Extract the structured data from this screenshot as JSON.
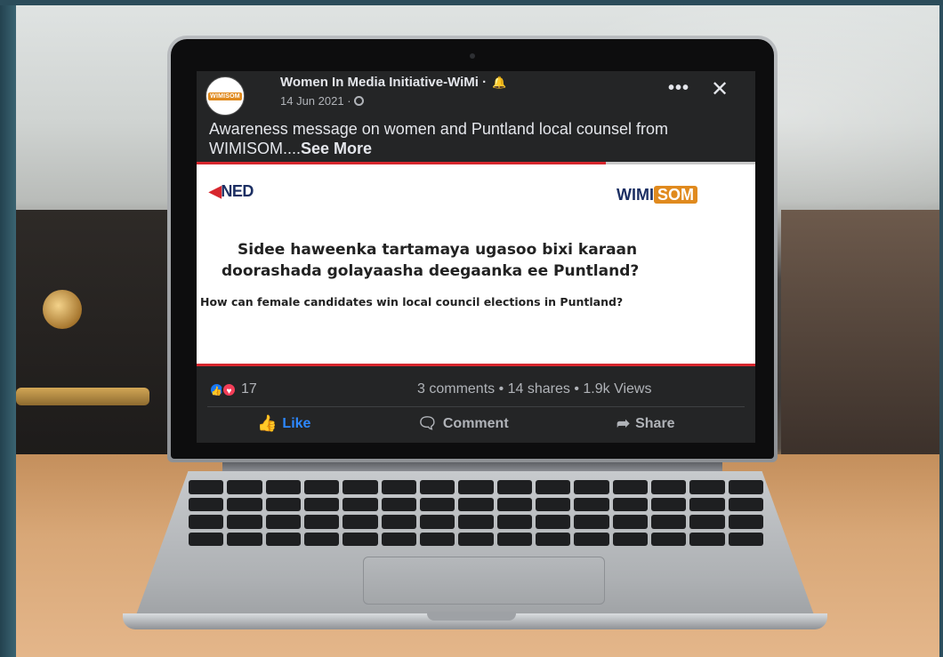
{
  "post": {
    "author": "Women In Media Initiative-WiMi",
    "author_suffix": "·",
    "date": "14 Jun 2021",
    "date_separator": "·",
    "caption": "Awareness message on women and Puntland local counsel from WIMISOM....",
    "see_more": "See More",
    "more_label": "•••",
    "close_label": "✕",
    "avatar_text": "WIMISOM"
  },
  "image": {
    "ned_logo_main": "NED",
    "wimi_logo_main": "WIMI",
    "wimi_logo_accent": "SOM",
    "line1": "Sidee haweenka tartamaya ugasoo bixi karaan",
    "line2": "doorashada golayaasha deegaanka ee Puntland?",
    "line3": "How can female candidates win local council elections in Puntland?"
  },
  "stats": {
    "reaction_count": "17",
    "counts_text": "3 comments • 14 shares • 1.9k Views"
  },
  "actions": {
    "like": "Like",
    "comment": "Comment",
    "share": "Share"
  },
  "colors": {
    "accent_blue": "#2d88ff",
    "love_red": "#f33e58",
    "card_bg": "#242526",
    "banner_red": "#d7262d"
  },
  "icons": {
    "like": "thumbs-up-icon",
    "love": "heart-icon",
    "comment": "comment-bubble-icon",
    "share": "share-arrow-icon",
    "bell": "bell-icon",
    "globe": "globe-icon"
  }
}
